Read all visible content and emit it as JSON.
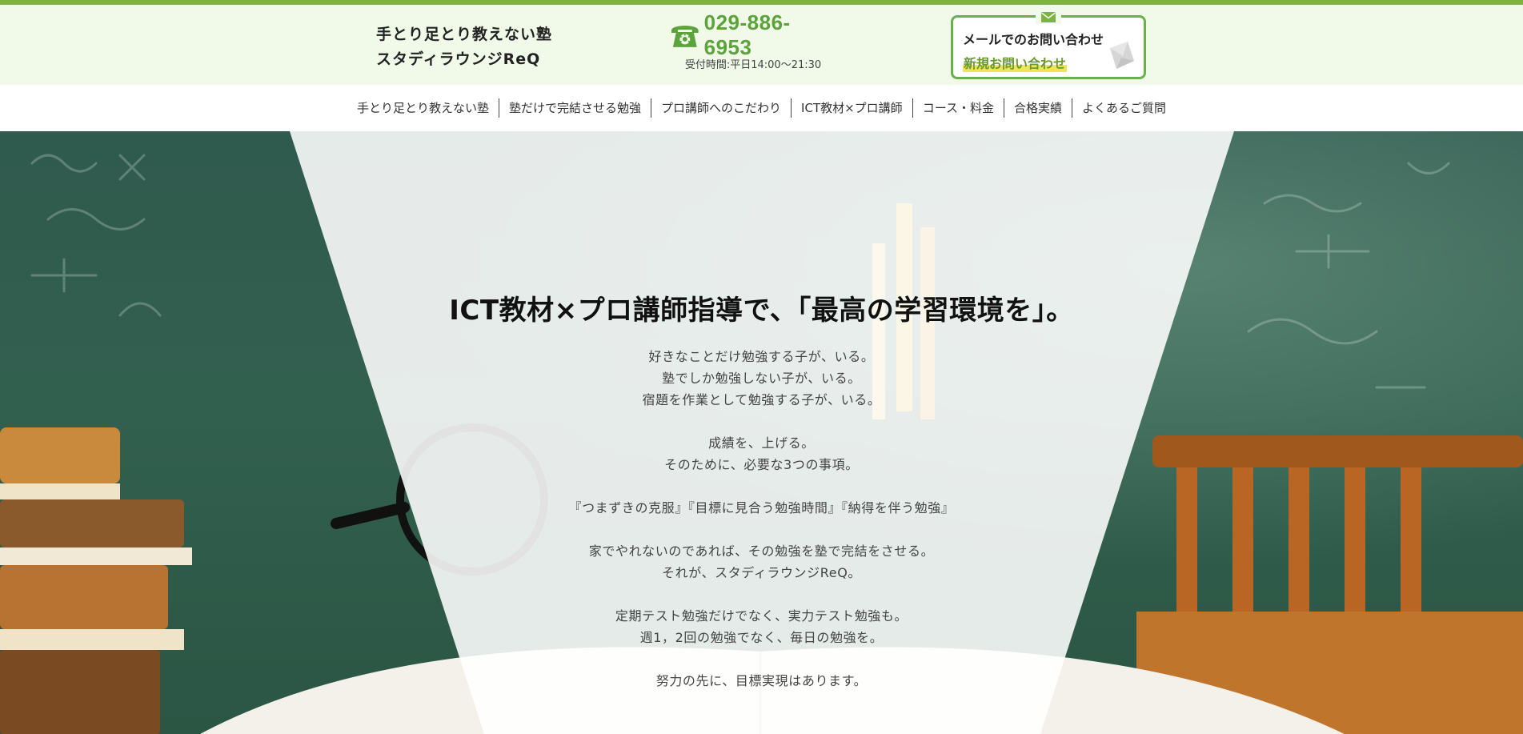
{
  "header": {
    "brand_line1": "手とり足とり教えない塾",
    "brand_line2": "スタディラウンジReQ",
    "phone_number": "029-886-6953",
    "phone_icon": "telephone-icon",
    "hours": "受付時間:平日14:00～21:30",
    "mail_icon": "envelope-icon",
    "mail_title": "メールでのお問い合わせ",
    "mail_link": "新規お問い合わせ"
  },
  "nav": {
    "items": [
      "手とり足とり教えない塾",
      "塾だけで完結させる勉強",
      "プロ講師へのこだわり",
      "ICT教材×プロ講師",
      "コース・料金",
      "合格実績",
      "よくあるご質問"
    ]
  },
  "hero": {
    "title": "ICT教材×プロ講師指導で、「最高の学習環境を」。",
    "lines": [
      "好きなことだけ勉強する子が、いる。",
      "塾でしか勉強しない子が、いる。",
      "宿題を作業として勉強する子が、いる。",
      "",
      "成績を、上げる。",
      "そのために、必要な3つの事項。",
      "",
      "『つまずきの克服』『目標に見合う勉強時間』『納得を伴う勉強』",
      "",
      "家でやれないのであれば、その勉強を塾で完結をさせる。",
      "それが、スタディラウンジReQ。",
      "",
      "定期テスト勉強だけでなく、実力テスト勉強も。",
      "週1，2回の勉強でなく、毎日の勉強を。",
      "",
      "努力の先に、目標実現はあります。"
    ]
  },
  "colors": {
    "accent_green": "#7cb342",
    "phone_green": "#5ba33a",
    "header_bg": "#f1f9e9",
    "chalkboard": "#2f5a4e"
  }
}
